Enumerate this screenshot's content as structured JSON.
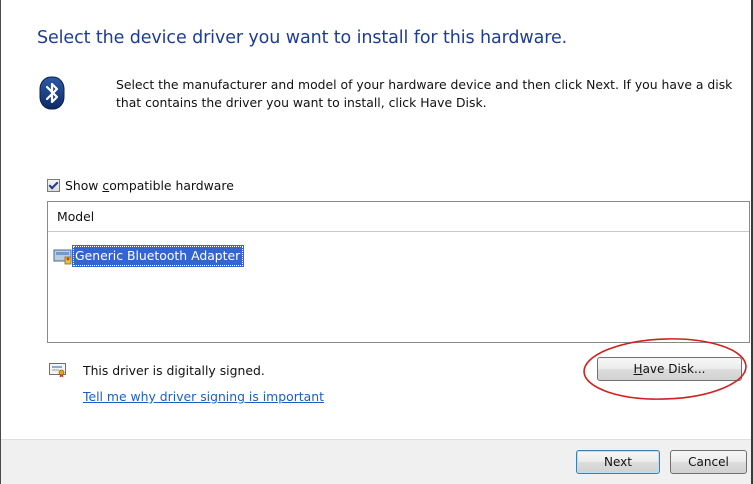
{
  "heading": "Select the device driver you want to install for this hardware.",
  "instructions": "Select the manufacturer and model of your hardware device and then click Next. If you have a disk that contains the driver you want to install, click Have Disk.",
  "compatible": {
    "label_prefix": "Show ",
    "label_accel": "c",
    "label_suffix": "ompatible hardware",
    "checked": true
  },
  "model_list": {
    "header": "Model",
    "items": [
      {
        "label": "Generic Bluetooth Adapter",
        "selected": true
      }
    ]
  },
  "signing": {
    "status": "This driver is digitally signed.",
    "link": "Tell me why driver signing is important"
  },
  "buttons": {
    "have_disk_accel": "H",
    "have_disk_rest": "ave Disk...",
    "next": "Next",
    "cancel": "Cancel"
  },
  "icons": {
    "bluetooth": "bluetooth-icon",
    "hardware": "hardware-icon",
    "certificate": "certificate-icon"
  },
  "colors": {
    "heading": "#1e3c96",
    "selection": "#3366cc",
    "link": "#1a5fc9",
    "annotation": "#d02020"
  }
}
